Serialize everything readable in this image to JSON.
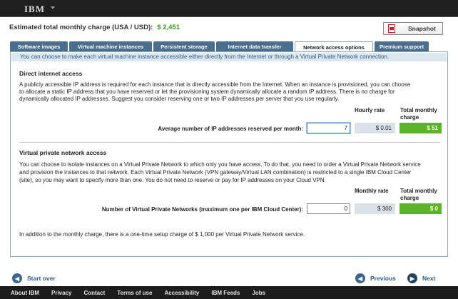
{
  "header": {
    "logo": "IBM"
  },
  "estimate": {
    "label": "Estimated total monthly charge (USA / USD):",
    "value": "$ 2,451"
  },
  "snapshot": {
    "label": "Snapshot"
  },
  "tabs": [
    {
      "label": "Software images"
    },
    {
      "label": "Virtual machine instances"
    },
    {
      "label": "Persistent storage"
    },
    {
      "label": "Internet data transfer"
    },
    {
      "label": "Network access options"
    },
    {
      "label": "Premium support"
    }
  ],
  "intro": "You can choose to make each virtual machine instance accessible either directly from the Internet or through a Virtual Private Network connection.",
  "internet": {
    "title": "Direct internet access",
    "p1": "A publicly accessible IP address is required for each instance that is directly accessible from the Internet. When an instance is provisioned, you can choose",
    "p2": "to allocate a static IP address that you have reserved or let the provisioning system dynamically allocate a random IP address. There is no charge for",
    "p3": "dynamically allocated IP addresses. Suggest you consider reserving one or two IP addresses per server that you use regularly.",
    "rate_header": "Hourly rate",
    "total_header_1": "Total monthly",
    "total_header_2": "charge",
    "row_label": "Average number of IP addresses reserved per month:",
    "value": "7",
    "rate": "$ 0.01",
    "total": "$ 51"
  },
  "vpn": {
    "title": "Virtual private network access",
    "p1": "You can choose to isolate instances on a Virtual Private Network to which only you have access. To do that, you need to order a Virtual Private Network service",
    "p2": "and provision the instances to that network. Each Virtual Private Network (VPN gateway/Virtual LAN combination) is restricted to a single IBM Cloud Center",
    "p3": "(site), so you may want to specify more than one. You do not need to reserve or pay for IP addresses on your Cloud VPN.",
    "rate_header": "Monthly rate",
    "total_header_1": "Total monthly",
    "total_header_2": "charge",
    "row_label": "Number of Virtual Private Networks (maximum one per IBM Cloud Center):",
    "value": "0",
    "rate": "$ 300",
    "total": "$ 0",
    "note": "In addition to the monthly charge, there is a one-time setup charge of $ 1,000  per Virtual Private Network service."
  },
  "nav": {
    "start_over": "Start over",
    "previous": "Previous",
    "next": "Next"
  },
  "footer": [
    "About IBM",
    "Privacy",
    "Contact",
    "Terms of use",
    "Accessibility",
    "IBM Feeds",
    "Jobs"
  ]
}
